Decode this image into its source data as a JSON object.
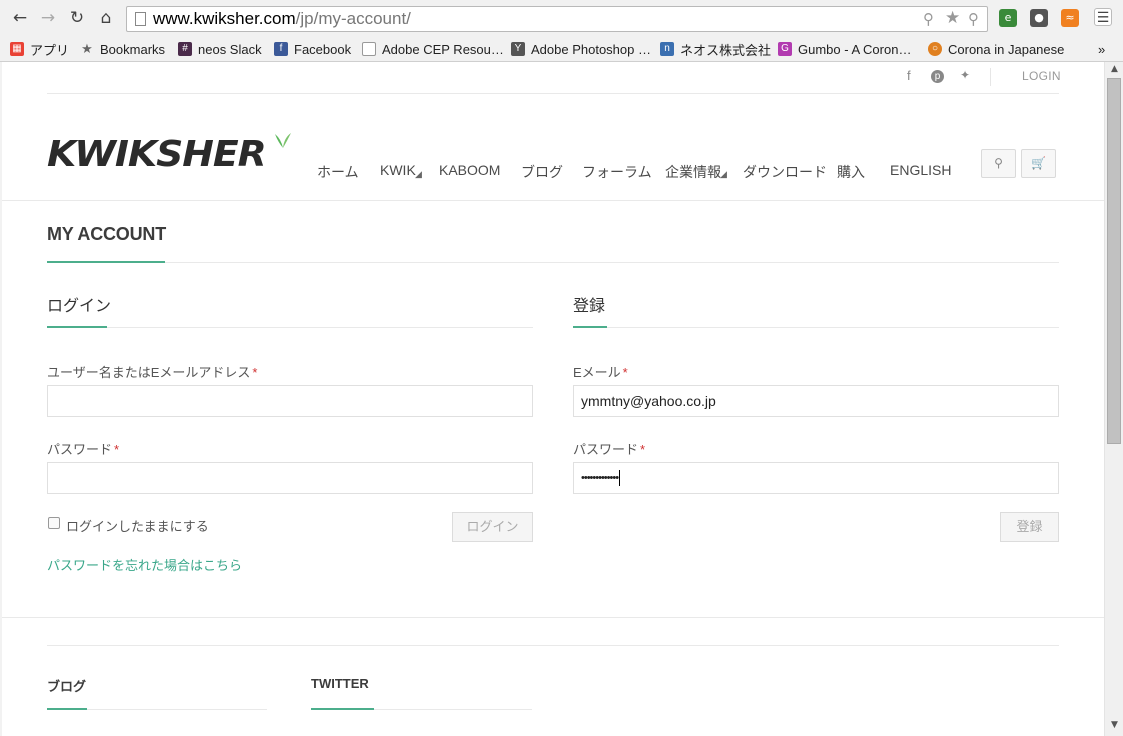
{
  "browser": {
    "url_host": "www.kwiksher.com",
    "url_path": "/jp/my-account/",
    "bookmarks": [
      {
        "label": "アプリ",
        "icon": "apps-grid-icon",
        "color": "#e94235"
      },
      {
        "label": "Bookmarks",
        "icon": "star-icon",
        "color": "#666666"
      },
      {
        "label": "neos Slack",
        "icon": "slack-icon",
        "color": "#4a2a4a"
      },
      {
        "label": "Facebook",
        "icon": "facebook-icon",
        "color": "#3b5998"
      },
      {
        "label": "Adobe CEP Resou…",
        "icon": "page-icon",
        "color": "#999999"
      },
      {
        "label": "Adobe Photoshop …",
        "icon": "photoshop-icon",
        "color": "#555555"
      },
      {
        "label": "ネオス株式会社",
        "icon": "neos-icon",
        "color": "#3b6fb0"
      },
      {
        "label": "Gumbo - A Coron…",
        "icon": "gumbo-icon",
        "color": "#b23bb0"
      },
      {
        "label": "Corona in Japanese",
        "icon": "corona-icon",
        "color": "#e08020"
      }
    ],
    "overflow": "»"
  },
  "site": {
    "logo_text": "KWIKSHER",
    "login_link": "LOGIN",
    "social": [
      "facebook-icon",
      "pinterest-icon",
      "twitter-icon"
    ],
    "nav": [
      "ホーム",
      "KWIK",
      "KABOOM",
      "ブログ",
      "フォーラム",
      "企業情報",
      "ダウンロード",
      "購入",
      "ENGLISH"
    ],
    "accent_color": "#4cae8c"
  },
  "account": {
    "page_title": "MY ACCOUNT",
    "login": {
      "title": "ログイン",
      "username_label": "ユーザー名またはEメールアドレス",
      "password_label": "パスワード",
      "required_mark": "*",
      "username_value": "",
      "password_value": "",
      "remember_label": "ログインしたままにする",
      "submit_label": "ログイン",
      "forgot_link": "パスワードを忘れた場合はこちら"
    },
    "register": {
      "title": "登録",
      "email_label": "Eメール",
      "password_label": "パスワード",
      "required_mark": "*",
      "email_value": "ymmtny@yahoo.co.jp",
      "password_value": "•••••••••••••",
      "submit_label": "登録"
    }
  },
  "footer": {
    "col1_title": "ブログ",
    "col2_title": "TWITTER"
  }
}
